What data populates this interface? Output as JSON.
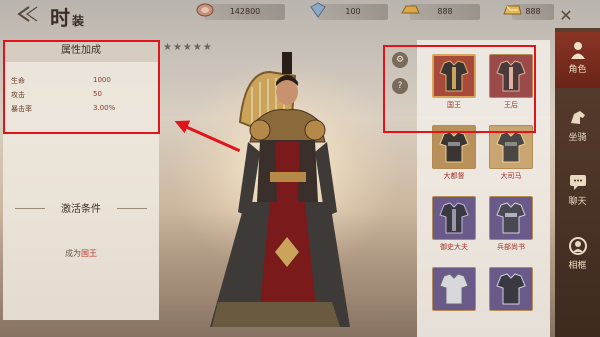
{
  "header": {
    "title_main": "时",
    "title_sub": "装",
    "currencies": [
      {
        "value": "142800",
        "icon": "gem-coin-icon",
        "color": "#c4907a"
      },
      {
        "value": "100",
        "icon": "diamond-icon",
        "color": "#8fa9c4"
      },
      {
        "value": "888",
        "icon": "gold-ingot-icon",
        "color": "#d9a84a"
      },
      {
        "value": "888",
        "icon": "gold-bar-icon",
        "color": "#e1b85a"
      }
    ]
  },
  "attributes": {
    "heading": "属性加成",
    "stats": [
      {
        "name": "生命",
        "value": "1000"
      },
      {
        "name": "攻击",
        "value": "50"
      },
      {
        "name": "暴击率",
        "value": "3.00%"
      }
    ]
  },
  "activation": {
    "heading": "激活条件",
    "prefix": "成为",
    "highlight": "国王"
  },
  "stars": "★★★★★",
  "costumes": [
    {
      "label": "国王",
      "tone": "red",
      "selected": true
    },
    {
      "label": "王后",
      "tone": "red",
      "selected": false
    },
    {
      "label": "大都督",
      "tone": "gold",
      "selected": false
    },
    {
      "label": "大司马",
      "tone": "gold",
      "selected": false
    },
    {
      "label": "御史大夫",
      "tone": "purple",
      "selected": false
    },
    {
      "label": "兵部尚书",
      "tone": "purple",
      "selected": false
    },
    {
      "label": "",
      "tone": "purple",
      "selected": false
    },
    {
      "label": "",
      "tone": "purple",
      "selected": false
    }
  ],
  "side_buttons": [
    "⚙",
    "?"
  ],
  "nav": [
    {
      "label": "角色",
      "icon": "character-icon",
      "active": true
    },
    {
      "label": "坐骑",
      "icon": "mount-icon",
      "active": false
    },
    {
      "label": "聊天",
      "icon": "chat-icon",
      "active": false
    },
    {
      "label": "相框",
      "icon": "frame-icon",
      "active": false
    }
  ],
  "colors": {
    "accent_red": "#e0141a",
    "label_red": "#a0352a",
    "nav_bg": "#4a3226",
    "nav_active": "#7a2c1e"
  }
}
